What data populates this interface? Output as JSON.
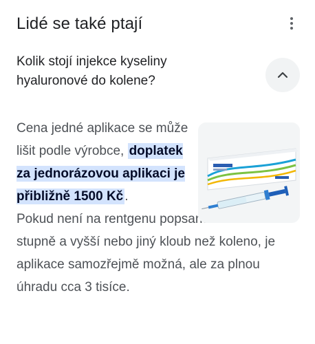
{
  "section": {
    "title": "Lidé se také ptají",
    "more_icon": "more-vert-icon"
  },
  "question": {
    "text": "Kolik stojí injekce kyseliny hyaluronové do kolene?",
    "toggle_icon": "chevron-up-icon"
  },
  "answer": {
    "intro": "Cena jedné aplikace se může lišit podle výrobce, ",
    "highlight": "doplatek za jednorázovou aplikaci je přibližně 1500 Kč",
    "after_highlight": ".",
    "rest": "Pokud není na rentgenu popsaná artróza II. stupně a vyšší nebo jiný kloub než koleno, je aplikace samozřejmě možná, ale za plnou úhradu cca 3 tisíce.",
    "image_alt_icon": "syringe-box-image"
  },
  "colors": {
    "text_primary": "#202124",
    "text_secondary": "#4d5156",
    "highlight_bg": "#d3e3fd",
    "toggle_bg": "#f1f3f4"
  }
}
